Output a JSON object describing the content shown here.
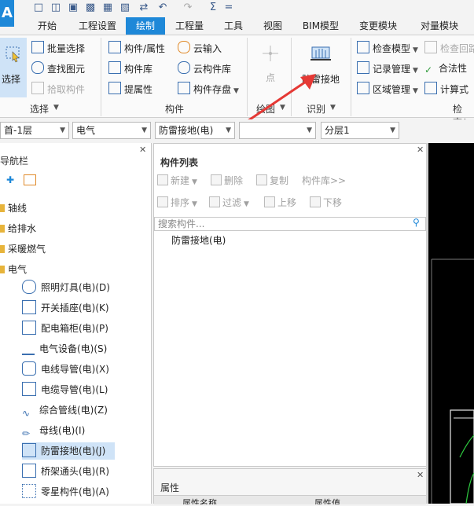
{
  "app": {
    "logo": "A"
  },
  "quick_access": {
    "undo": "↶",
    "redo": "↷",
    "sum": "Σ",
    "more": "="
  },
  "tabs": [
    {
      "label": "开始"
    },
    {
      "label": "工程设置"
    },
    {
      "label": "绘制"
    },
    {
      "label": "工程量"
    },
    {
      "label": "工具"
    },
    {
      "label": "视图"
    },
    {
      "label": "BIM模型"
    },
    {
      "label": "变更模块"
    },
    {
      "label": "对量模块"
    }
  ],
  "ribbon": {
    "select": {
      "big_label": "选择",
      "batch": "批量选择",
      "find": "查找图元",
      "pick": "拾取构件",
      "group": "选择"
    },
    "component": {
      "attr": "构件/属性",
      "lib": "构件库",
      "extract": "提属性",
      "cloud_input": "云输入",
      "cloud_lib": "云构件库",
      "save": "构件存盘",
      "group": "构件"
    },
    "draw": {
      "point": "点",
      "group": "绘图"
    },
    "identify": {
      "lightning": "防雷接地",
      "group": "识别"
    },
    "check": {
      "model": "检查模型",
      "loop": "检查回路",
      "record": "记录管理",
      "legal": "合法性",
      "region": "区域管理",
      "calc": "计算式",
      "group": "检查/"
    }
  },
  "combos": {
    "floor": "首-1层",
    "discipline": "电气",
    "type": "防雷接地(电)",
    "empty": "",
    "layer": "分层1"
  },
  "nav": {
    "title": "导航栏",
    "folders": [
      {
        "label": "轴线"
      },
      {
        "label": "给排水"
      },
      {
        "label": "采暖燃气"
      },
      {
        "label": "电气"
      }
    ],
    "items": [
      {
        "label": "照明灯具(电)(D)"
      },
      {
        "label": "开关插座(电)(K)"
      },
      {
        "label": "配电箱柜(电)(P)"
      },
      {
        "label": "电气设备(电)(S)"
      },
      {
        "label": "电线导管(电)(X)"
      },
      {
        "label": "电缆导管(电)(L)"
      },
      {
        "label": "综合管线(电)(Z)"
      },
      {
        "label": "母线(电)(I)"
      },
      {
        "label": "防雷接地(电)(J)"
      },
      {
        "label": "桥架通头(电)(R)"
      },
      {
        "label": "零星构件(电)(A)"
      }
    ]
  },
  "component_list": {
    "title": "构件列表",
    "toolbar": {
      "new": "新建",
      "delete": "删除",
      "copy": "复制",
      "lib": "构件库>>",
      "sort": "排序",
      "filter": "过滤",
      "up": "上移",
      "down": "下移"
    },
    "search_placeholder": "搜索构件...",
    "tree": [
      {
        "label": "防雷接地(电)"
      }
    ]
  },
  "properties": {
    "title": "属性",
    "col_name": "属性名称",
    "col_value": "属性值"
  },
  "colors": {
    "accent": "#1e88d8",
    "selected": "#cfe3f7",
    "arrow": "#e53935"
  }
}
